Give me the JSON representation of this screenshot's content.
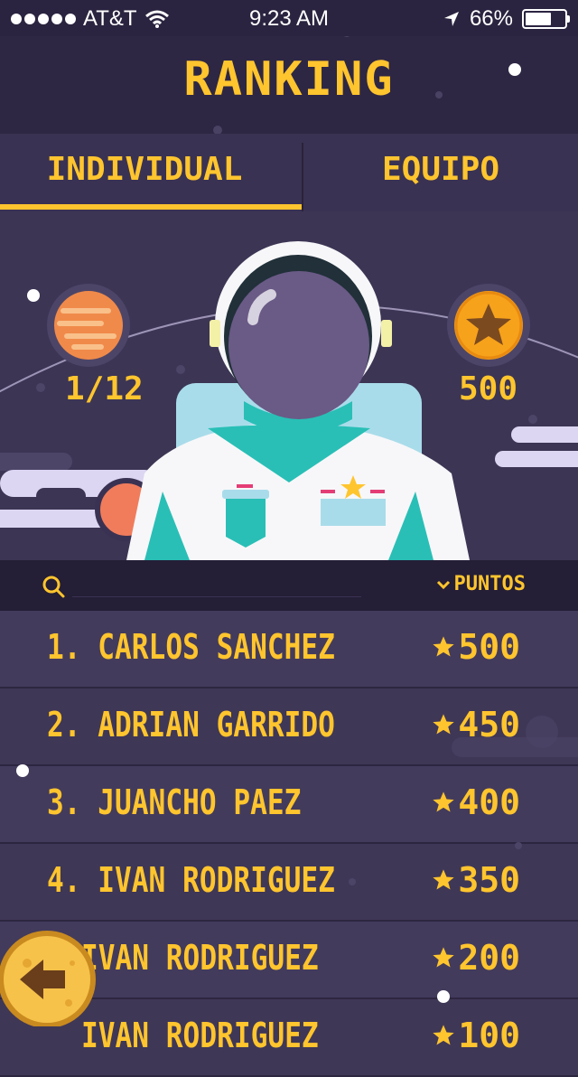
{
  "status": {
    "carrier": "AT&T",
    "time": "9:23 AM",
    "battery": "66%"
  },
  "header": {
    "title": "RANKING"
  },
  "tabs": [
    {
      "label": "INDIVIDUAL",
      "active": true
    },
    {
      "label": "EQUIPO",
      "active": false
    }
  ],
  "hero": {
    "level": "1/12",
    "points": "500"
  },
  "search": {
    "placeholder": "",
    "sort_label": "PUNTOS"
  },
  "ranking": [
    {
      "name": "1. CARLOS SANCHEZ",
      "points": "500"
    },
    {
      "name": "2. ADRIAN GARRIDO",
      "points": "450"
    },
    {
      "name": "3. JUANCHO PAEZ",
      "points": "400"
    },
    {
      "name": "4. IVAN RODRIGUEZ",
      "points": "350"
    },
    {
      "name": "IVAN RODRIGUEZ",
      "points": "200"
    },
    {
      "name": "IVAN RODRIGUEZ",
      "points": "100"
    }
  ],
  "colors": {
    "accent": "#ffc52e",
    "background": "#2b2440",
    "row": "#433b5c"
  }
}
